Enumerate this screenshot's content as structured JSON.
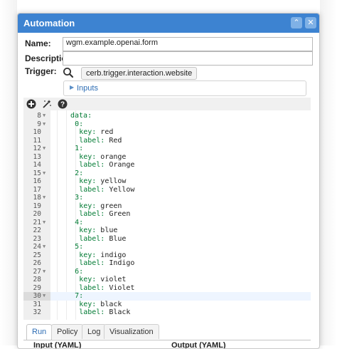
{
  "dialog": {
    "title": "Automation",
    "minimize_glyph": "⌃",
    "close_glyph": "✕"
  },
  "form": {
    "name_label": "Name:",
    "name_value": "wgm.example.openai.form",
    "description_label": "Description:",
    "description_value": "",
    "trigger_label": "Trigger:",
    "trigger_value": "cerb.trigger.interaction.website",
    "inputs_label": "Inputs"
  },
  "editor": {
    "lines": [
      {
        "n": "8",
        "fold": true,
        "indent": 1,
        "key": "data:",
        "val": ""
      },
      {
        "n": "9",
        "fold": true,
        "indent": 2,
        "key": "0:",
        "val": ""
      },
      {
        "n": "10",
        "fold": false,
        "indent": 3,
        "key": "key:",
        "val": " red"
      },
      {
        "n": "11",
        "fold": false,
        "indent": 3,
        "key": "label:",
        "val": " Red"
      },
      {
        "n": "12",
        "fold": true,
        "indent": 2,
        "key": "1:",
        "val": ""
      },
      {
        "n": "13",
        "fold": false,
        "indent": 3,
        "key": "key:",
        "val": " orange"
      },
      {
        "n": "14",
        "fold": false,
        "indent": 3,
        "key": "label:",
        "val": " Orange"
      },
      {
        "n": "15",
        "fold": true,
        "indent": 2,
        "key": "2:",
        "val": ""
      },
      {
        "n": "16",
        "fold": false,
        "indent": 3,
        "key": "key:",
        "val": " yellow"
      },
      {
        "n": "17",
        "fold": false,
        "indent": 3,
        "key": "label:",
        "val": " Yellow"
      },
      {
        "n": "18",
        "fold": true,
        "indent": 2,
        "key": "3:",
        "val": ""
      },
      {
        "n": "19",
        "fold": false,
        "indent": 3,
        "key": "key:",
        "val": " green"
      },
      {
        "n": "20",
        "fold": false,
        "indent": 3,
        "key": "label:",
        "val": " Green"
      },
      {
        "n": "21",
        "fold": true,
        "indent": 2,
        "key": "4:",
        "val": ""
      },
      {
        "n": "22",
        "fold": false,
        "indent": 3,
        "key": "key:",
        "val": " blue"
      },
      {
        "n": "23",
        "fold": false,
        "indent": 3,
        "key": "label:",
        "val": " Blue"
      },
      {
        "n": "24",
        "fold": true,
        "indent": 2,
        "key": "5:",
        "val": ""
      },
      {
        "n": "25",
        "fold": false,
        "indent": 3,
        "key": "key:",
        "val": " indigo"
      },
      {
        "n": "26",
        "fold": false,
        "indent": 3,
        "key": "label:",
        "val": " Indigo"
      },
      {
        "n": "27",
        "fold": true,
        "indent": 2,
        "key": "6:",
        "val": ""
      },
      {
        "n": "28",
        "fold": false,
        "indent": 3,
        "key": "key:",
        "val": " violet"
      },
      {
        "n": "29",
        "fold": false,
        "indent": 3,
        "key": "label:",
        "val": " Violet"
      },
      {
        "n": "30",
        "fold": true,
        "indent": 2,
        "key": "7:",
        "val": "",
        "active": true
      },
      {
        "n": "31",
        "fold": false,
        "indent": 3,
        "key": "key:",
        "val": " black"
      },
      {
        "n": "32",
        "fold": false,
        "indent": 3,
        "key": "label:",
        "val": " Black"
      }
    ]
  },
  "tabs": [
    {
      "label": "Run",
      "active": true
    },
    {
      "label": "Policy",
      "active": false
    },
    {
      "label": "Log",
      "active": false
    },
    {
      "label": "Visualization",
      "active": false
    }
  ],
  "bottom": {
    "input_label": "Input (YAML)",
    "output_label": "Output (YAML)"
  },
  "colors": {
    "titlebar": "#3d83d1",
    "yaml_key": "#007a33",
    "link": "#2d6db4"
  },
  "icons": [
    "search-icon",
    "add-icon",
    "magic-wand-icon",
    "help-icon",
    "collapse-icon",
    "close-icon",
    "caret-right-icon"
  ]
}
